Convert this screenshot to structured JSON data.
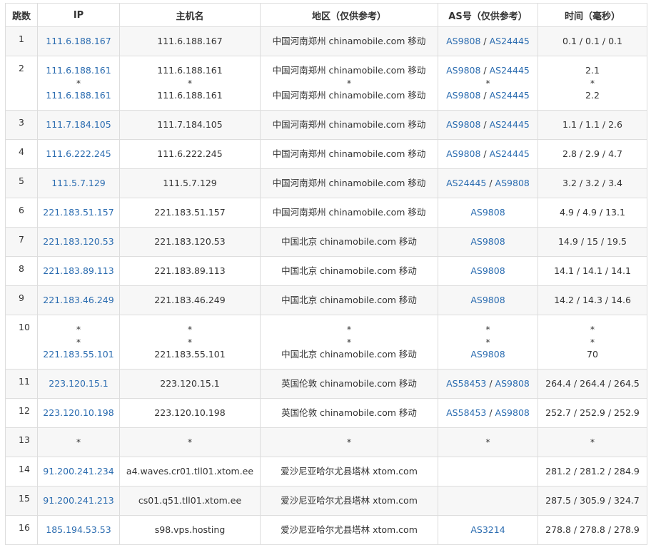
{
  "colors": {
    "link": "#2b6cb0",
    "text": "#333333",
    "border": "#dddddd",
    "stripe": "#f7f7f7"
  },
  "headers": [
    "跳数",
    "IP",
    "主机名",
    "地区（仅供参考）",
    "AS号（仅供参考）",
    "时间（毫秒）"
  ],
  "rows": [
    {
      "hop": "1",
      "lines": [
        {
          "ip": "111.6.188.167",
          "host": "111.6.188.167",
          "region": "中国河南郑州 chinamobile.com 移动",
          "asn": [
            "AS9808",
            "AS24445"
          ],
          "time": "0.1 / 0.1 / 0.1"
        }
      ]
    },
    {
      "hop": "2",
      "lines": [
        {
          "ip": "111.6.188.161",
          "host": "111.6.188.161",
          "region": "中国河南郑州 chinamobile.com 移动",
          "asn": [
            "AS9808",
            "AS24445"
          ],
          "time": "2.1"
        },
        {
          "ip": "*",
          "host": "*",
          "region": "*",
          "asn": [
            "*"
          ],
          "time": "*"
        },
        {
          "ip": "111.6.188.161",
          "host": "111.6.188.161",
          "region": "中国河南郑州 chinamobile.com 移动",
          "asn": [
            "AS9808",
            "AS24445"
          ],
          "time": "2.2"
        }
      ]
    },
    {
      "hop": "3",
      "lines": [
        {
          "ip": "111.7.184.105",
          "host": "111.7.184.105",
          "region": "中国河南郑州 chinamobile.com 移动",
          "asn": [
            "AS9808",
            "AS24445"
          ],
          "time": "1.1 / 1.1 / 2.6"
        }
      ]
    },
    {
      "hop": "4",
      "lines": [
        {
          "ip": "111.6.222.245",
          "host": "111.6.222.245",
          "region": "中国河南郑州 chinamobile.com 移动",
          "asn": [
            "AS9808",
            "AS24445"
          ],
          "time": "2.8 / 2.9 / 4.7"
        }
      ]
    },
    {
      "hop": "5",
      "lines": [
        {
          "ip": "111.5.7.129",
          "host": "111.5.7.129",
          "region": "中国河南郑州 chinamobile.com 移动",
          "asn": [
            "AS24445",
            "AS9808"
          ],
          "time": "3.2 / 3.2 / 3.4"
        }
      ]
    },
    {
      "hop": "6",
      "lines": [
        {
          "ip": "221.183.51.157",
          "host": "221.183.51.157",
          "region": "中国河南郑州 chinamobile.com 移动",
          "asn": [
            "AS9808"
          ],
          "time": "4.9 / 4.9 / 13.1"
        }
      ]
    },
    {
      "hop": "7",
      "lines": [
        {
          "ip": "221.183.120.53",
          "host": "221.183.120.53",
          "region": "中国北京 chinamobile.com 移动",
          "asn": [
            "AS9808"
          ],
          "time": "14.9 / 15 / 19.5"
        }
      ]
    },
    {
      "hop": "8",
      "lines": [
        {
          "ip": "221.183.89.113",
          "host": "221.183.89.113",
          "region": "中国北京 chinamobile.com 移动",
          "asn": [
            "AS9808"
          ],
          "time": "14.1 / 14.1 / 14.1"
        }
      ]
    },
    {
      "hop": "9",
      "lines": [
        {
          "ip": "221.183.46.249",
          "host": "221.183.46.249",
          "region": "中国北京 chinamobile.com 移动",
          "asn": [
            "AS9808"
          ],
          "time": "14.2 / 14.3 / 14.6"
        }
      ]
    },
    {
      "hop": "10",
      "lines": [
        {
          "ip": "*",
          "host": "*",
          "region": "*",
          "asn": [
            "*"
          ],
          "time": "*"
        },
        {
          "ip": "*",
          "host": "*",
          "region": "*",
          "asn": [
            "*"
          ],
          "time": "*"
        },
        {
          "ip": "221.183.55.101",
          "host": "221.183.55.101",
          "region": "中国北京 chinamobile.com 移动",
          "asn": [
            "AS9808"
          ],
          "time": "70"
        }
      ]
    },
    {
      "hop": "11",
      "lines": [
        {
          "ip": "223.120.15.1",
          "host": "223.120.15.1",
          "region": "英国伦敦 chinamobile.com 移动",
          "asn": [
            "AS58453",
            "AS9808"
          ],
          "time": "264.4 / 264.4 / 264.5"
        }
      ]
    },
    {
      "hop": "12",
      "lines": [
        {
          "ip": "223.120.10.198",
          "host": "223.120.10.198",
          "region": "英国伦敦 chinamobile.com 移动",
          "asn": [
            "AS58453",
            "AS9808"
          ],
          "time": "252.7 / 252.9 / 252.9"
        }
      ]
    },
    {
      "hop": "13",
      "lines": [
        {
          "ip": "*",
          "host": "*",
          "region": "*",
          "asn": [
            "*"
          ],
          "time": "*"
        }
      ]
    },
    {
      "hop": "14",
      "lines": [
        {
          "ip": "91.200.241.234",
          "host": "a4.waves.cr01.tll01.xtom.ee",
          "region": "爱沙尼亚哈尔尤县塔林 xtom.com",
          "asn": [],
          "time": "281.2 / 281.2 / 284.9"
        }
      ]
    },
    {
      "hop": "15",
      "lines": [
        {
          "ip": "91.200.241.213",
          "host": "cs01.q51.tll01.xtom.ee",
          "region": "爱沙尼亚哈尔尤县塔林 xtom.com",
          "asn": [],
          "time": "287.5 / 305.9 / 324.7"
        }
      ]
    },
    {
      "hop": "16",
      "lines": [
        {
          "ip": "185.194.53.53",
          "host": "s98.vps.hosting",
          "region": "爱沙尼亚哈尔尤县塔林 xtom.com",
          "asn": [
            "AS3214"
          ],
          "time": "278.8 / 278.8 / 278.9"
        }
      ]
    }
  ]
}
